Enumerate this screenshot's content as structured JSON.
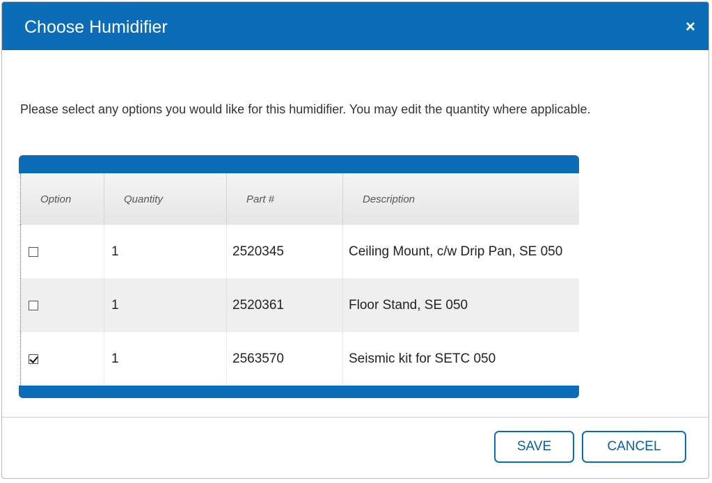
{
  "dialog": {
    "title": "Choose Humidifier",
    "close_symbol": "×",
    "instructions": "Please select any options you would like for this humidifier. You may edit the quantity where applicable."
  },
  "table": {
    "headers": {
      "option": "Option",
      "quantity": "Quantity",
      "part": "Part #",
      "description": "Description"
    },
    "rows": [
      {
        "checked": false,
        "quantity": "1",
        "part": "2520345",
        "description": "Ceiling Mount, c/w Drip Pan, SE 050"
      },
      {
        "checked": false,
        "quantity": "1",
        "part": "2520361",
        "description": "Floor Stand, SE 050"
      },
      {
        "checked": true,
        "quantity": "1",
        "part": "2563570",
        "description": "Seismic kit for SETC 050"
      }
    ]
  },
  "buttons": {
    "save": "SAVE",
    "cancel": "CANCEL"
  },
  "colors": {
    "accent": "#0b6db7",
    "row_alt": "#efefef"
  },
  "icons": {
    "close": "close-icon",
    "checkbox": "checkbox"
  }
}
